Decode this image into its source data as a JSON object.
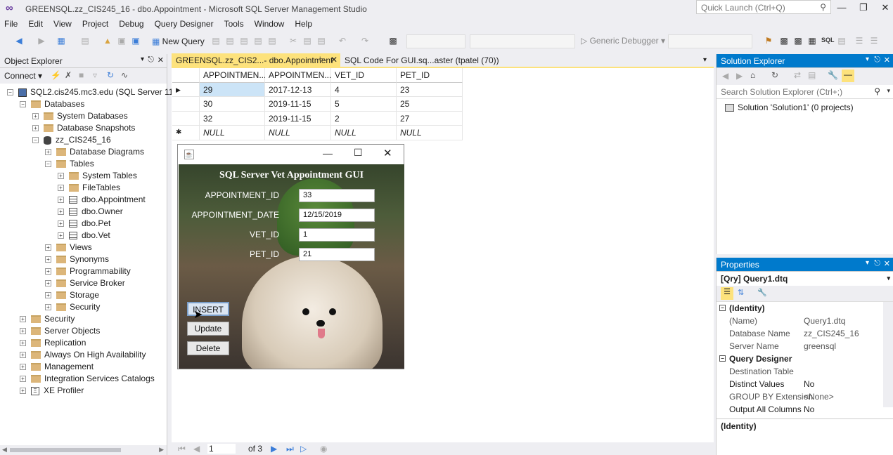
{
  "window": {
    "title": "GREENSQL.zz_CIS245_16 - dbo.Appointment - Microsoft SQL Server Management Studio",
    "quick_launch_placeholder": "Quick Launch (Ctrl+Q)"
  },
  "menu": [
    "File",
    "Edit",
    "View",
    "Project",
    "Debug",
    "Query Designer",
    "Tools",
    "Window",
    "Help"
  ],
  "toolbar": {
    "new_query": "New Query",
    "debugger": "Generic Debugger",
    "sql_label": "SQL"
  },
  "object_explorer": {
    "title": "Object Explorer",
    "connect": "Connect",
    "tree": [
      {
        "label": "SQL2.cis245.mc3.edu (SQL Server 11.0.!"
      },
      {
        "label": "Databases"
      },
      {
        "label": "System Databases"
      },
      {
        "label": "Database Snapshots"
      },
      {
        "label": "zz_CIS245_16"
      },
      {
        "label": "Database Diagrams"
      },
      {
        "label": "Tables"
      },
      {
        "label": "System Tables"
      },
      {
        "label": "FileTables"
      },
      {
        "label": "dbo.Appointment"
      },
      {
        "label": "dbo.Owner"
      },
      {
        "label": "dbo.Pet"
      },
      {
        "label": "dbo.Vet"
      },
      {
        "label": "Views"
      },
      {
        "label": "Synonyms"
      },
      {
        "label": "Programmability"
      },
      {
        "label": "Service Broker"
      },
      {
        "label": "Storage"
      },
      {
        "label": "Security"
      },
      {
        "label": "Security"
      },
      {
        "label": "Server Objects"
      },
      {
        "label": "Replication"
      },
      {
        "label": "Always On High Availability"
      },
      {
        "label": "Management"
      },
      {
        "label": "Integration Services Catalogs"
      },
      {
        "label": "XE Profiler"
      }
    ]
  },
  "tabs": [
    {
      "label": "GREENSQL.zz_CIS2...- dbo.Appointment"
    },
    {
      "label": "SQL Code For GUI.sq...aster (tpatel (70))"
    }
  ],
  "grid": {
    "columns": [
      "APPOINTMEN...",
      "APPOINTMEN...",
      "VET_ID",
      "PET_ID"
    ],
    "rows": [
      [
        "29",
        "2017-12-13",
        "4",
        "23"
      ],
      [
        "30",
        "2019-11-15",
        "5",
        "25"
      ],
      [
        "32",
        "2019-11-15",
        "2",
        "27"
      ],
      [
        "NULL",
        "NULL",
        "NULL",
        "NULL"
      ]
    ]
  },
  "java_app": {
    "title": "SQL Server Vet Appointment GUI",
    "fields": [
      {
        "label": "APPOINTMENT_ID",
        "value": "33"
      },
      {
        "label": "APPOINTMENT_DATE",
        "value": "12/15/2019"
      },
      {
        "label": "VET_ID",
        "value": "1"
      },
      {
        "label": "PET_ID",
        "value": "21"
      }
    ],
    "buttons": [
      "INSERT",
      "Update",
      "Delete"
    ]
  },
  "pager": {
    "page": "1",
    "of": "of 3"
  },
  "solution_explorer": {
    "title": "Solution Explorer",
    "search_placeholder": "Search Solution Explorer (Ctrl+;)",
    "solution": "Solution 'Solution1' (0 projects)"
  },
  "properties": {
    "title": "Properties",
    "object": "[Qry] Query1.dtq",
    "sections": [
      {
        "name": "(Identity)",
        "rows": [
          {
            "k": "(Name)",
            "v": "Query1.dtq"
          },
          {
            "k": "Database Name",
            "v": "zz_CIS245_16"
          },
          {
            "k": "Server Name",
            "v": "greensql"
          }
        ]
      },
      {
        "name": "Query Designer",
        "rows": [
          {
            "k": "Destination Table",
            "v": ""
          },
          {
            "k": "Distinct Values",
            "v": "No"
          },
          {
            "k": "GROUP BY Extension",
            "v": "<None>"
          },
          {
            "k": "Output All Columns",
            "v": "No"
          }
        ]
      }
    ],
    "footer": "(Identity)"
  },
  "colors": {
    "accent": "#007acc",
    "selection": "#cce4f7"
  }
}
